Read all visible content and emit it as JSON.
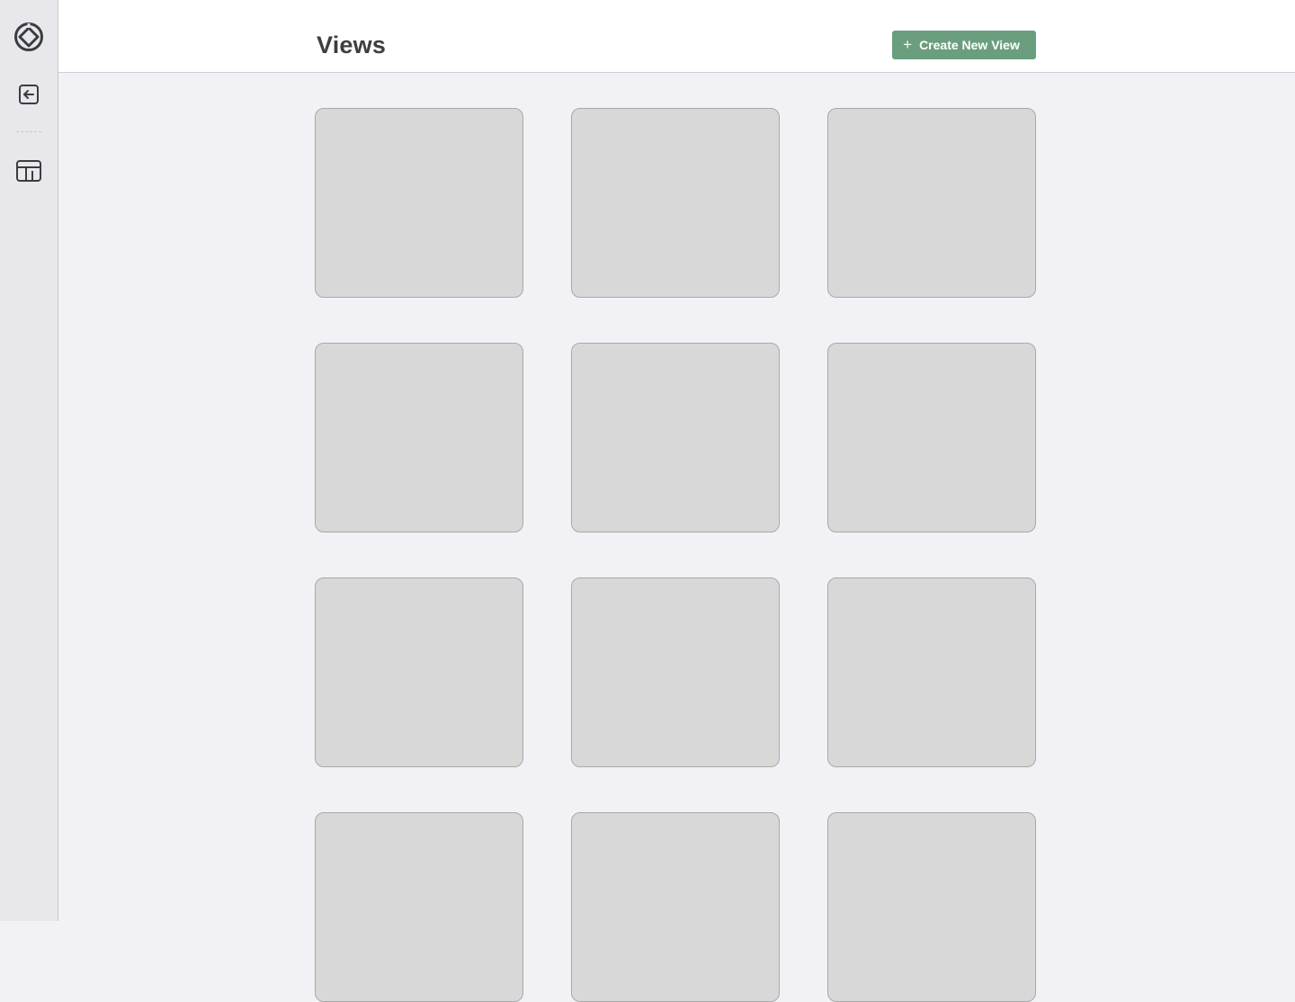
{
  "header": {
    "title": "Views",
    "create_button_label": "Create New View",
    "create_button_icon": "plus-icon",
    "accent_color": "#6a9e7e"
  },
  "sidebar": {
    "items": [
      {
        "icon": "logo-icon",
        "label": ""
      },
      {
        "icon": "back-arrow-icon",
        "label": ""
      },
      {
        "icon": "views-icon",
        "label": ""
      }
    ]
  },
  "views": {
    "cards": [
      {
        "state": "loading"
      },
      {
        "state": "loading"
      },
      {
        "state": "loading"
      },
      {
        "state": "loading"
      },
      {
        "state": "loading"
      },
      {
        "state": "loading"
      },
      {
        "state": "loading"
      },
      {
        "state": "loading"
      },
      {
        "state": "loading"
      },
      {
        "state": "loading"
      },
      {
        "state": "loading"
      },
      {
        "state": "loading"
      }
    ]
  }
}
